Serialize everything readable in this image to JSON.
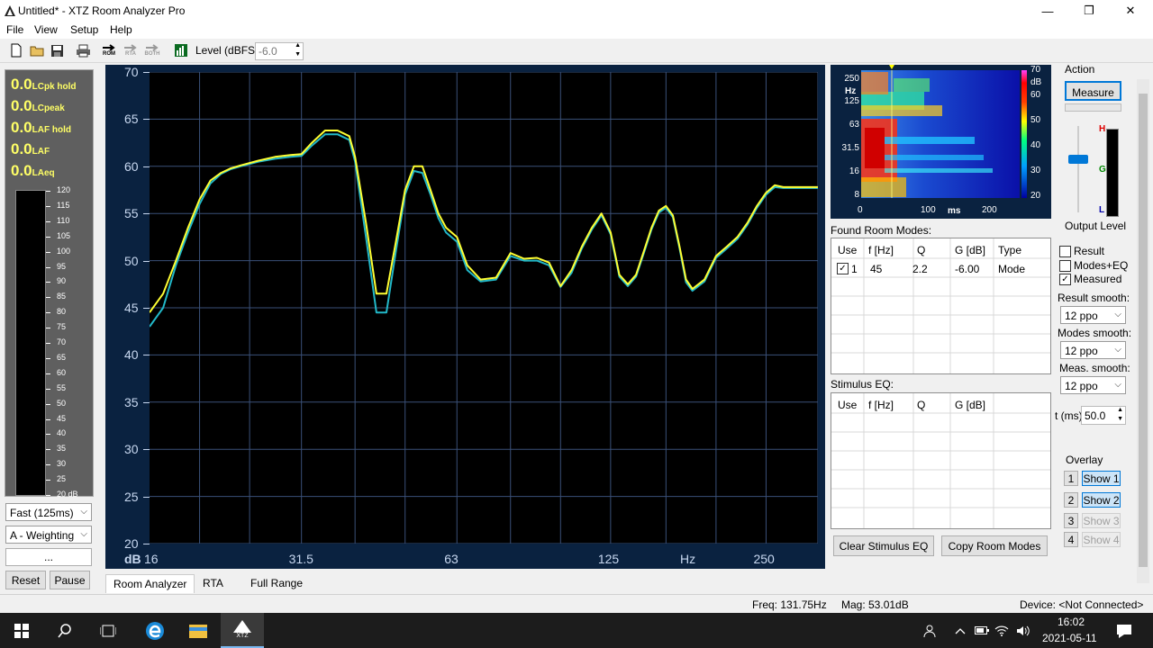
{
  "window": {
    "title": "Untitled* - XTZ Room Analyzer Pro",
    "minimize_glyph": "—",
    "restore_glyph": "❐",
    "close_glyph": "✕"
  },
  "menu": [
    "File",
    "View",
    "Setup",
    "Help"
  ],
  "toolbar": {
    "rom_label": "ROM",
    "rta_label": "RTA",
    "both_label": "BOTH",
    "level_label": "Level (dBFS)",
    "level_value": "-6.0"
  },
  "meters": {
    "rows": [
      {
        "value": "0.0",
        "label": "LCpk hold"
      },
      {
        "value": "0.0",
        "label": "LCpeak"
      },
      {
        "value": "0.0",
        "label": "LAF hold"
      },
      {
        "value": "0.0",
        "label": "LAF"
      },
      {
        "value": "0.0",
        "label": "LAeq"
      }
    ],
    "scale": [
      "120",
      "115",
      "110",
      "105",
      "100",
      "95",
      "90",
      "85",
      "80",
      "75",
      "70",
      "65",
      "60",
      "55",
      "50",
      "45",
      "40",
      "35",
      "30",
      "25",
      "20 dB"
    ],
    "speed_value": "Fast (125ms)",
    "weighting_value": "A - Weighting",
    "ellipsis_label": "...",
    "reset_label": "Reset",
    "pause_label": "Pause"
  },
  "graph": {
    "y_ticks": [
      "70",
      "65",
      "60",
      "55",
      "50",
      "45",
      "40",
      "35",
      "30",
      "25",
      "20"
    ],
    "x_ticks": [
      "16",
      "31.5",
      "63",
      "125",
      "250"
    ],
    "x_unit": "Hz",
    "y_unit": "dB",
    "colors": {
      "yellow": "#ffff33",
      "cyan": "#22b8c8",
      "grid": "#3a5078"
    }
  },
  "chart_data": {
    "type": "line",
    "xlabel": "Hz",
    "ylabel": "dB",
    "xscale": "log",
    "xlim": [
      16,
      315
    ],
    "ylim": [
      20,
      70
    ],
    "grid": true,
    "series": [
      {
        "color": "#ffff33",
        "x": [
          16,
          17,
          18,
          19,
          20,
          21,
          22,
          23,
          24,
          26,
          28,
          30,
          31.5,
          33,
          35,
          37,
          39,
          40,
          42,
          44,
          46,
          48,
          50,
          52,
          54,
          56,
          58,
          60,
          63,
          66,
          70,
          75,
          80,
          85,
          90,
          95,
          100,
          105,
          110,
          115,
          120,
          125,
          130,
          135,
          140,
          145,
          150,
          155,
          160,
          165,
          170,
          175,
          180,
          190,
          200,
          210,
          220,
          230,
          240,
          250,
          260,
          270,
          280,
          290,
          300,
          315
        ],
        "y": [
          44.5,
          46.5,
          50,
          53.5,
          56.5,
          58.5,
          59.3,
          59.8,
          60.1,
          60.6,
          61,
          61.2,
          61.3,
          62.5,
          63.8,
          63.8,
          63.2,
          61,
          54,
          46.5,
          46.5,
          52,
          57.5,
          60,
          60,
          57.5,
          55,
          53.5,
          52.5,
          49.5,
          48,
          48.2,
          50.8,
          50.2,
          50.3,
          49.8,
          47.3,
          49,
          51.5,
          53.5,
          55,
          53,
          48.5,
          47.5,
          48.5,
          51,
          53.5,
          55.3,
          55.8,
          54.8,
          51.5,
          48,
          47,
          48,
          50.5,
          51.5,
          52.5,
          54,
          55.8,
          57.2,
          58,
          57.8,
          57.8,
          57.8,
          57.8,
          57.8
        ]
      },
      {
        "color": "#22b8c8",
        "x": [
          16,
          17,
          18,
          19,
          20,
          21,
          22,
          23,
          24,
          26,
          28,
          30,
          31.5,
          33,
          35,
          37,
          39,
          40,
          42,
          44,
          46,
          48,
          50,
          52,
          54,
          56,
          58,
          60,
          63,
          66,
          70,
          75,
          80,
          85,
          90,
          95,
          100,
          105,
          110,
          115,
          120,
          125,
          130,
          135,
          140,
          145,
          150,
          155,
          160,
          165,
          170,
          175,
          180,
          190,
          200,
          210,
          220,
          230,
          240,
          250,
          260,
          270,
          280,
          290,
          300,
          315
        ],
        "y": [
          43,
          45,
          49.5,
          53,
          56,
          58.2,
          59.2,
          59.7,
          60,
          60.5,
          60.8,
          61,
          61.1,
          62.2,
          63.4,
          63.4,
          62.8,
          60.5,
          52.5,
          44.5,
          44.5,
          51,
          57,
          59.5,
          59.3,
          57,
          54.5,
          53,
          52,
          49,
          47.8,
          48,
          50.5,
          50,
          50,
          49.5,
          47.2,
          48.7,
          51.3,
          53.3,
          54.8,
          52.8,
          48.3,
          47.3,
          48.3,
          50.8,
          53.3,
          55.1,
          55.6,
          54.6,
          51.3,
          47.7,
          46.8,
          47.8,
          50.3,
          51.3,
          52.3,
          53.8,
          55.6,
          57,
          57.8,
          57.7,
          57.7,
          57.7,
          57.7,
          57.7
        ]
      }
    ]
  },
  "spectrogram": {
    "y_ticks": [
      "250",
      "125",
      "63",
      "31.5",
      "16",
      "8"
    ],
    "y_unit": "Hz",
    "x_ticks": [
      "0",
      "100",
      "200"
    ],
    "x_unit": "ms",
    "scale": [
      "70",
      "60",
      "50",
      "40",
      "30",
      "20"
    ],
    "scale_unit": "dB"
  },
  "room_modes": {
    "label": "Found Room Modes:",
    "columns": [
      "Use",
      "f [Hz]",
      "Q",
      "G [dB]",
      "Type"
    ],
    "rows": [
      {
        "use_checked": true,
        "num": "1",
        "f": "45",
        "q": "2.2",
        "g": "-6.00",
        "type": "Mode"
      }
    ]
  },
  "stimulus_eq": {
    "label": "Stimulus EQ:",
    "columns": [
      "Use",
      "f [Hz]",
      "Q",
      "G [dB]"
    ]
  },
  "buttons": {
    "clear_stimulus": "Clear Stimulus EQ",
    "copy_modes": "Copy Room Modes"
  },
  "action": {
    "label": "Action",
    "measure_label": "Measure",
    "output_level_label": "Output Level",
    "meter_letters": {
      "h": "H",
      "g": "G",
      "l": "L"
    }
  },
  "options": {
    "result_label": "Result",
    "result_checked": false,
    "modes_eq_label": "Modes+EQ",
    "modes_eq_checked": false,
    "measured_label": "Measured",
    "measured_checked": true,
    "result_smooth_label": "Result smooth:",
    "result_smooth_value": "12 ppo",
    "modes_smooth_label": "Modes smooth:",
    "modes_smooth_value": "12 ppo",
    "meas_smooth_label": "Meas. smooth:",
    "meas_smooth_value": "12 ppo",
    "t_label": "t (ms)",
    "t_value": "50.0"
  },
  "overlay": {
    "label": "Overlay",
    "items": [
      {
        "num": "1",
        "label": "Show 1",
        "enabled": true
      },
      {
        "num": "2",
        "label": "Show 2",
        "enabled": true
      },
      {
        "num": "3",
        "label": "Show 3",
        "enabled": false
      },
      {
        "num": "4",
        "label": "Show 4",
        "enabled": false
      }
    ]
  },
  "tabs": [
    "Room Analyzer",
    "RTA",
    "Full Range"
  ],
  "status": {
    "freq": "Freq: 131.75Hz",
    "mag": "Mag: 53.01dB",
    "device": "Device: <Not Connected>"
  },
  "taskbar": {
    "time": "16:02",
    "date": "2021-05-11",
    "xtz_label": "XTZ"
  }
}
